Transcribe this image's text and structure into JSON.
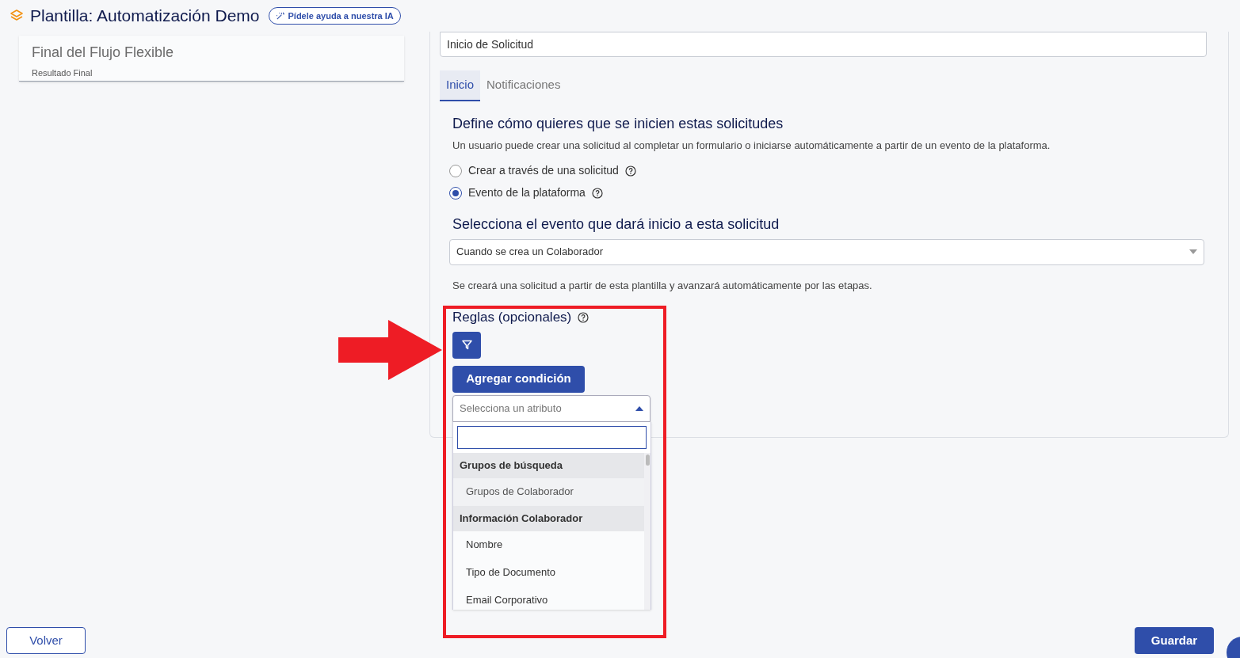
{
  "header": {
    "title": "Plantilla: Automatización Demo",
    "ai_button": "Pídele ayuda a nuestra IA"
  },
  "stage_card": {
    "title": "Final del Flujo Flexible",
    "subtitle": "Resultado Final"
  },
  "stage_name": {
    "value": "Inicio de Solicitud"
  },
  "tabs": [
    {
      "label": "Inicio",
      "selected": true
    },
    {
      "label": "Notificaciones",
      "selected": false
    }
  ],
  "start_section": {
    "heading": "Define cómo quieres que se inicien estas solicitudes",
    "description": "Un usuario puede crear una solicitud al completar un formulario o iniciarse automáticamente a partir de un evento de la plataforma.",
    "options": [
      {
        "label": "Crear a través de una solicitud",
        "selected": false
      },
      {
        "label": "Evento de la plataforma",
        "selected": true
      }
    ]
  },
  "event_section": {
    "heading": "Selecciona el evento que dará inicio a esta solicitud",
    "select_value": "Cuando se crea un Colaborador",
    "note": "Se creará una solicitud a partir de esta plantilla y avanzará automáticamente por las etapas."
  },
  "rules": {
    "heading": "Reglas (opcionales)",
    "add_button": "Agregar condición",
    "attribute_placeholder": "Selecciona un atributo",
    "expanded": true,
    "items": [
      {
        "kind": "group",
        "label": "Grupos de búsqueda"
      },
      {
        "kind": "option",
        "label": "Grupos de Colaborador",
        "highlighted": true
      },
      {
        "kind": "group",
        "label": "Información Colaborador"
      },
      {
        "kind": "option",
        "label": "Nombre",
        "highlighted": false
      },
      {
        "kind": "option",
        "label": "Tipo de Documento",
        "highlighted": false
      },
      {
        "kind": "option",
        "label": "Email Corporativo",
        "highlighted": false
      }
    ]
  },
  "footer": {
    "back_button": "Volver",
    "save_button": "Guardar"
  }
}
